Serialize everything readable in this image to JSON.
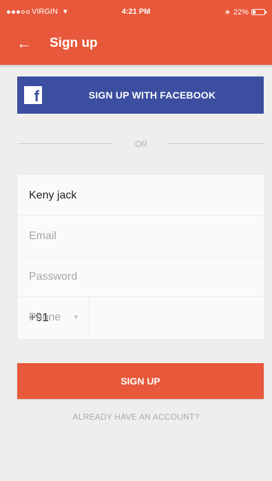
{
  "status_bar": {
    "carrier": "VIRGIN",
    "time": "4:21 PM",
    "battery": "22%",
    "battery_level": 0.22,
    "wifi_icon": "wifi-icon",
    "bluetooth_icon": "bluetooth-icon"
  },
  "app_bar": {
    "back_icon": "arrow-left-icon",
    "title": "Sign up"
  },
  "facebook": {
    "icon": "facebook-icon",
    "label": "SIGN UP WITH FACEBOOK"
  },
  "divider": {
    "or_text": "OR"
  },
  "form": {
    "name_value": "Keny jack",
    "email_placeholder": "Email",
    "password_placeholder": "Password",
    "country_code": "+91",
    "phone_placeholder": "Phone"
  },
  "actions": {
    "signup_label": "SIGN UP",
    "login_link": "ALREADY HAVE AN ACCOUNT?"
  },
  "colors": {
    "primary": "#e8583a",
    "facebook": "#3c4ea0",
    "background": "#efeeed"
  }
}
